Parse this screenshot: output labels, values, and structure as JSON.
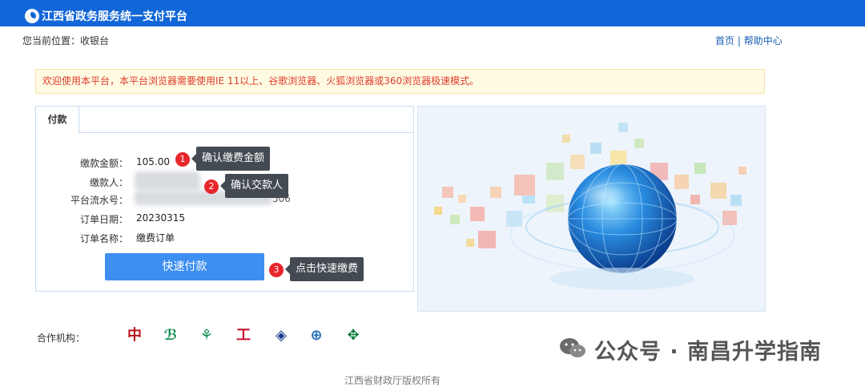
{
  "header": {
    "site_title": "江西省政务服务统一支付平台"
  },
  "location": {
    "text": "您当前位置：收银台"
  },
  "links": {
    "home": "首页",
    "sep": "|",
    "help": "帮助中心"
  },
  "notice": "欢迎使用本平台，本平台浏览器需要使用IE 11以上、谷歌浏览器、火狐浏览器或360浏览器极速模式。",
  "tab": {
    "label": "付款"
  },
  "fields": {
    "amount_label": "缴款金额：",
    "amount_value": "105.00",
    "payer_label": "缴款人：",
    "serial_label": "平台流水号：",
    "serial_value": "506",
    "date_label": "订单日期：",
    "date_value": "20230315",
    "name_label": "订单名称：",
    "name_value": "缴费订单"
  },
  "pay_button": "快速付款",
  "annotations": [
    {
      "num": "1",
      "text": "确认缴费金额"
    },
    {
      "num": "2",
      "text": "确认交款人"
    },
    {
      "num": "3",
      "text": "点击快速缴费"
    }
  ],
  "cooperation_label": "合作机构：",
  "banks": [
    {
      "icon": "bank-of-china-icon",
      "glyph": "中",
      "color": "#b3141c"
    },
    {
      "icon": "agricultural-development-bank-icon",
      "glyph": "ℬ",
      "color": "#0d8a4a"
    },
    {
      "icon": "agricultural-bank-icon",
      "glyph": "⚘",
      "color": "#0e8d4f"
    },
    {
      "icon": "icbc-icon",
      "glyph": "工",
      "color": "#c8102e"
    },
    {
      "icon": "bank-of-communications-icon",
      "glyph": "◈",
      "color": "#143c8c"
    },
    {
      "icon": "construction-bank-icon",
      "glyph": "⊕",
      "color": "#1f6bb5"
    },
    {
      "icon": "postal-savings-bank-icon",
      "glyph": "✥",
      "color": "#0b7d3c"
    }
  ],
  "watermark": "公众号 · 南昌升学指南",
  "footer": "江西省财政厅版权所有"
}
